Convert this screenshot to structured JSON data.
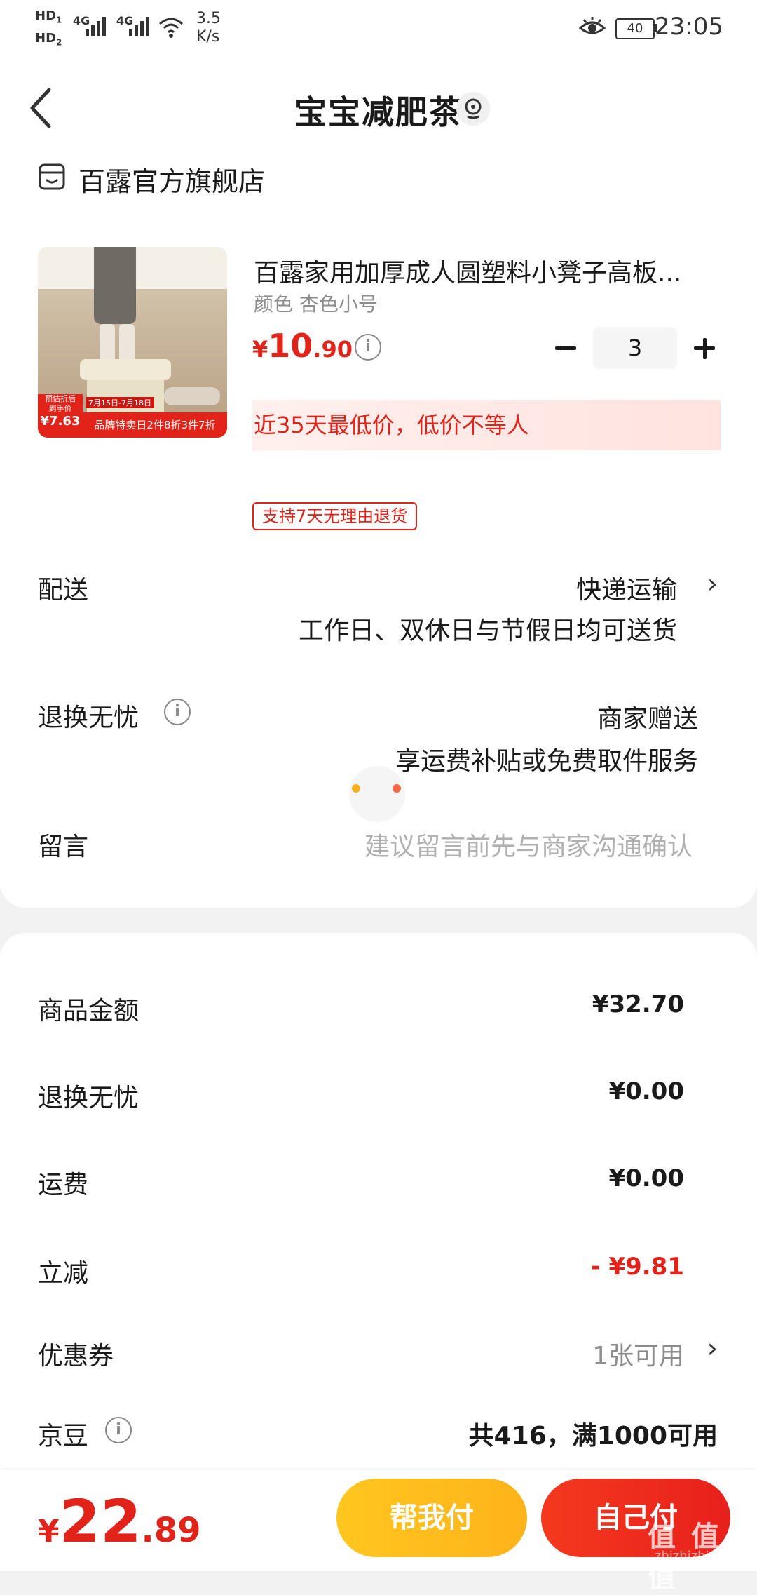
{
  "status_bar": {
    "hd1": "HD",
    "hd1_sub": "1",
    "hd2": "HD",
    "hd2_sub": "2",
    "sig1": "4G",
    "sig2": "4G",
    "speed_value": "3.5",
    "speed_unit": "K/s",
    "battery": "40",
    "time": "23:05"
  },
  "header": {
    "title": "宝宝减肥茶"
  },
  "shop": {
    "name": "百露官方旗舰店"
  },
  "product": {
    "title": "百露家用加厚成人圆塑料小凳子高板...",
    "spec": "颜色 杏色小号",
    "currency": "¥",
    "price_int": "10",
    "price_dec": ".90",
    "quantity": "3",
    "lowest_note": "近35天最低价，低价不等人",
    "return_tag": "支持7天无理由退货",
    "image": {
      "est_label_1": "预估折后",
      "est_label_2": "到手价",
      "est_price": "¥7.63",
      "date_range": "7月15日-7月18日",
      "promo": "品牌特卖日2件8折3件7折"
    }
  },
  "delivery": {
    "label": "配送",
    "method": "快递运输",
    "note": "工作日、双休日与节假日均可送货"
  },
  "worry_free": {
    "label": "退换无忧",
    "value": "商家赠送",
    "note": "享运费补贴或免费取件服务"
  },
  "message": {
    "label": "留言",
    "placeholder": "建议留言前先与商家沟通确认"
  },
  "summary": {
    "goods_label": "商品金额",
    "goods_amount": "¥32.70",
    "worry_label": "退换无忧",
    "worry_amount": "¥0.00",
    "freight_label": "运费",
    "freight_amount": "¥0.00",
    "discount_label": "立减",
    "discount_amount": "- ¥9.81",
    "coupon_label": "优惠券",
    "coupon_value": "1张可用",
    "jingdou_label": "京豆",
    "jingdou_value": "共416，满1000可用"
  },
  "footer": {
    "currency": "¥",
    "total_int": "22",
    "total_dec": ".89",
    "help_pay": "帮我付",
    "self_pay": "自己付",
    "watermark": "值 值 值",
    "watermark_url": "zhizhizhi.com"
  },
  "colors": {
    "accent": "#e2231a",
    "help_pay_gradient": "#ffbf1f",
    "self_pay_gradient": "#f0301e"
  }
}
